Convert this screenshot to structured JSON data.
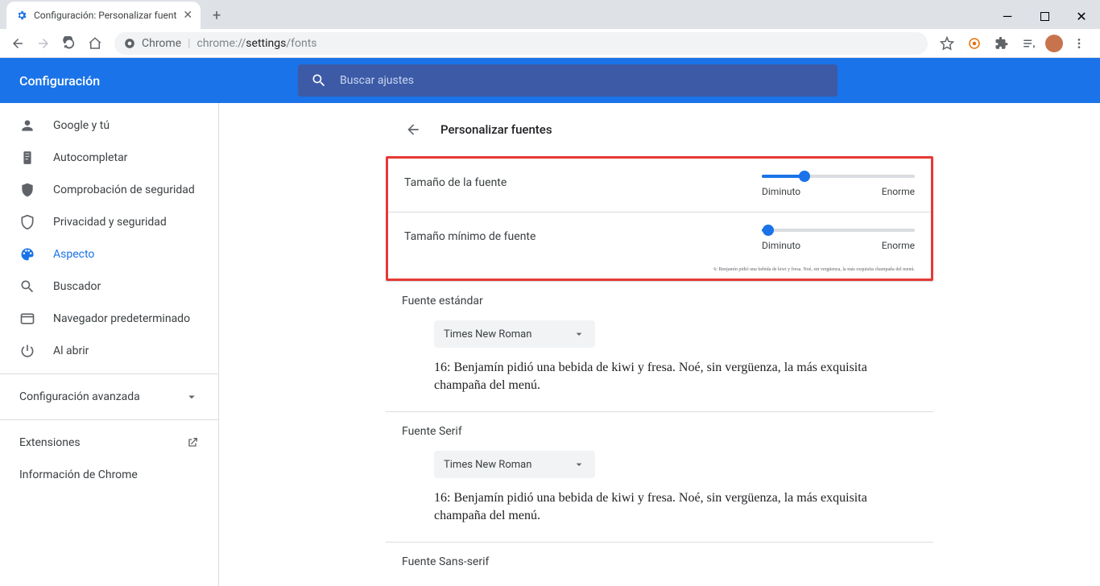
{
  "window": {
    "tab_title": "Configuración: Personalizar fuent",
    "minimize": "—",
    "maximize": "▢",
    "close": "✕"
  },
  "omnibox": {
    "prefix": "Chrome",
    "sep": "|",
    "url_grey": "chrome://",
    "url_bold": "settings",
    "url_tail": "/fonts"
  },
  "bluebar": {
    "title": "Configuración"
  },
  "search": {
    "placeholder": "Buscar ajustes"
  },
  "sidebar": {
    "items": [
      {
        "label": "Google y tú",
        "icon": "person"
      },
      {
        "label": "Autocompletar",
        "icon": "clipboard"
      },
      {
        "label": "Comprobación de seguridad",
        "icon": "shield-check"
      },
      {
        "label": "Privacidad y seguridad",
        "icon": "shield"
      },
      {
        "label": "Aspecto",
        "icon": "palette",
        "active": true
      },
      {
        "label": "Buscador",
        "icon": "search"
      },
      {
        "label": "Navegador predeterminado",
        "icon": "browser"
      },
      {
        "label": "Al abrir",
        "icon": "power"
      }
    ],
    "advanced": "Configuración avanzada",
    "footer": {
      "extensions": "Extensiones",
      "about": "Información de Chrome"
    }
  },
  "panel": {
    "title": "Personalizar fuentes",
    "font_size": {
      "label": "Tamaño de la fuente",
      "min": "Diminuto",
      "max": "Enorme",
      "percent": 28
    },
    "min_font_size": {
      "label": "Tamaño mínimo de fuente",
      "min": "Diminuto",
      "max": "Enorme",
      "percent": 4
    },
    "tiny_sample": "6: Benjamín pidió una bebida de kiwi y fresa. Noé, sin vergüenza, la más exquisita champaña del menú.",
    "standard": {
      "title": "Fuente estándar",
      "value": "Times New Roman",
      "sample": "16: Benjamín pidió una bebida de kiwi y fresa. Noé, sin vergüenza, la más exquisita champaña del menú."
    },
    "serif": {
      "title": "Fuente Serif",
      "value": "Times New Roman",
      "sample": "16: Benjamín pidió una bebida de kiwi y fresa. Noé, sin vergüenza, la más exquisita champaña del menú."
    },
    "sans": {
      "title": "Fuente Sans-serif"
    }
  }
}
